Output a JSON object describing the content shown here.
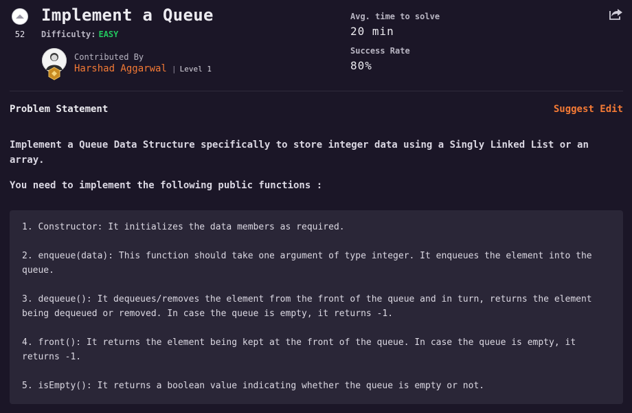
{
  "problem": {
    "title": "Implement a Queue",
    "difficulty_label": "Difficulty:",
    "difficulty_value": "EASY",
    "upvotes": "52"
  },
  "contributor": {
    "label": "Contributed By",
    "name": "Harshad Aggarwal",
    "level": "Level 1"
  },
  "stats": {
    "avg_time_label": "Avg. time to solve",
    "avg_time_value": "20 min",
    "success_rate_label": "Success Rate",
    "success_rate_value": "80%"
  },
  "statement": {
    "heading": "Problem Statement",
    "suggest_edit": "Suggest Edit",
    "intro": "Implement a Queue Data Structure specifically to store integer data using a Singly Linked List or an array.",
    "functions_intro": "You need to implement the following public functions :",
    "functions": [
      "1. Constructor: It initializes the data members as required.",
      "2. enqueue(data): This function should take one argument of type integer. It enqueues the element into the queue.",
      "3. dequeue(): It dequeues/removes the element from the front of the queue and in turn, returns the element being dequeued or removed. In case the queue is empty, it returns -1.",
      "4. front(): It returns the element being kept at the front of the queue. In case the queue is empty, it returns -1.",
      "5. isEmpty(): It returns a boolean value indicating whether the queue is empty or not."
    ]
  },
  "icons": {
    "upvote": "upvote-chevron-icon",
    "share": "share-icon",
    "badge": "level-badge-icon"
  },
  "colors": {
    "background": "#1b1627",
    "accent": "#f47a35",
    "easy": "#22c55e",
    "codebox": "#2a2637"
  }
}
